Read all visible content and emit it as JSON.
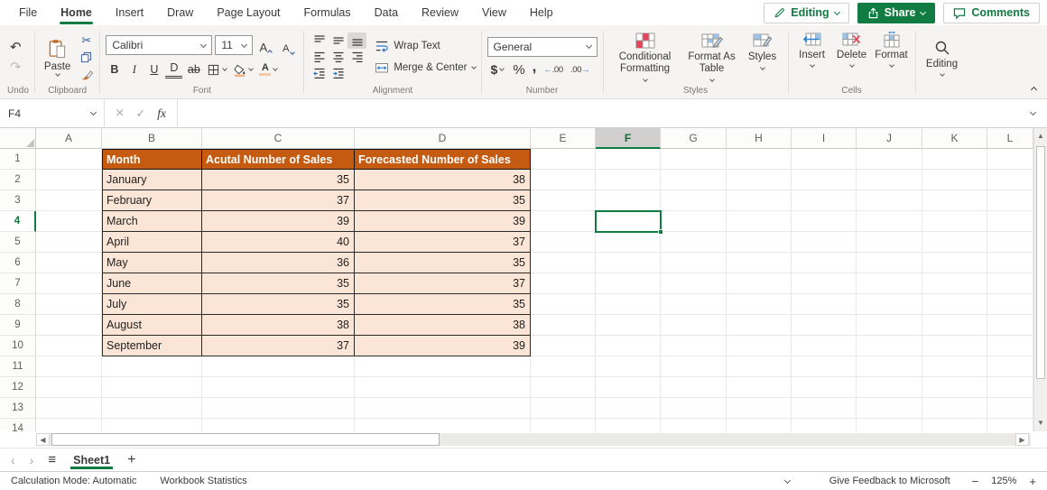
{
  "menu": {
    "tabs": [
      "File",
      "Home",
      "Insert",
      "Draw",
      "Page Layout",
      "Formulas",
      "Data",
      "Review",
      "View",
      "Help"
    ],
    "active": "Home"
  },
  "header_actions": {
    "editing": "Editing",
    "share": "Share",
    "comments": "Comments"
  },
  "ribbon": {
    "group_labels": {
      "undo": "Undo",
      "clipboard": "Clipboard",
      "font": "Font",
      "alignment": "Alignment",
      "number": "Number",
      "styles": "Styles",
      "cells": "Cells"
    },
    "clipboard": {
      "paste": "Paste"
    },
    "font": {
      "family": "Calibri",
      "size": "11",
      "bold": "B",
      "italic": "I",
      "underline": "U",
      "double_underline": "D",
      "strikethrough": "ab",
      "color_letter": "A"
    },
    "alignment": {
      "wrap_text": "Wrap Text",
      "merge_center": "Merge & Center"
    },
    "number": {
      "format": "General"
    },
    "styles": {
      "conditional_formatting": "Conditional Formatting",
      "format_as_table": "Format As Table",
      "cell_styles": "Styles"
    },
    "cells": {
      "insert": "Insert",
      "delete": "Delete",
      "format": "Format"
    },
    "editing": {
      "label": "Editing"
    }
  },
  "formula_bar": {
    "name_box": "F4",
    "fx_label": "fx",
    "value": ""
  },
  "grid": {
    "columns": [
      "A",
      "B",
      "C",
      "D",
      "E",
      "F",
      "G",
      "H",
      "I",
      "J",
      "K",
      "L"
    ],
    "rows": [
      "1",
      "2",
      "3",
      "4",
      "5",
      "6",
      "7",
      "8",
      "9",
      "10",
      "11",
      "12",
      "13",
      "14"
    ],
    "active_column": "F",
    "active_row": "4",
    "selected_cell": "F4"
  },
  "table": {
    "headers": [
      "Month",
      "Acutal Number of Sales",
      "Forecasted Number of Sales"
    ],
    "rows": [
      [
        "January",
        "35",
        "38"
      ],
      [
        "February",
        "37",
        "35"
      ],
      [
        "March",
        "39",
        "39"
      ],
      [
        "April",
        "40",
        "37"
      ],
      [
        "May",
        "36",
        "35"
      ],
      [
        "June",
        "35",
        "37"
      ],
      [
        "July",
        "35",
        "35"
      ],
      [
        "August",
        "38",
        "38"
      ],
      [
        "September",
        "37",
        "39"
      ]
    ]
  },
  "sheet_bar": {
    "active_tab": "Sheet1"
  },
  "status_bar": {
    "calculation_mode": "Calculation Mode: Automatic",
    "workbook_statistics": "Workbook Statistics",
    "feedback": "Give Feedback to Microsoft",
    "zoom_level": "125%",
    "zoom_out": "−",
    "zoom_in": "+"
  },
  "icons": {
    "undo": "↶",
    "redo": "↷",
    "cut": "✂",
    "font_letter": "A",
    "currency": "$",
    "percent": "%",
    "comma_style": ",",
    "dec_zeros": ".00",
    "arrow_left": "←",
    "arrow_right": "→",
    "cancel": "×",
    "enter": "✓",
    "scroll_up": "▲",
    "scroll_down": "▼",
    "scroll_left": "◀",
    "scroll_right": "▶",
    "sheet_nav_prev": "‹",
    "sheet_nav_next": "›",
    "sheet_menu": "≡",
    "add_sheet": "+"
  },
  "colors": {
    "accent_green": "#107C41",
    "table_header_bg": "#C55A11",
    "table_cell_bg": "#FBE5D6",
    "selection_border": "#107C41",
    "active_col_header_bg": "#D2D0CE",
    "icon_blue": "#2B579A",
    "icon_orange": "#C16A29",
    "icon_red": "#E8455A"
  }
}
